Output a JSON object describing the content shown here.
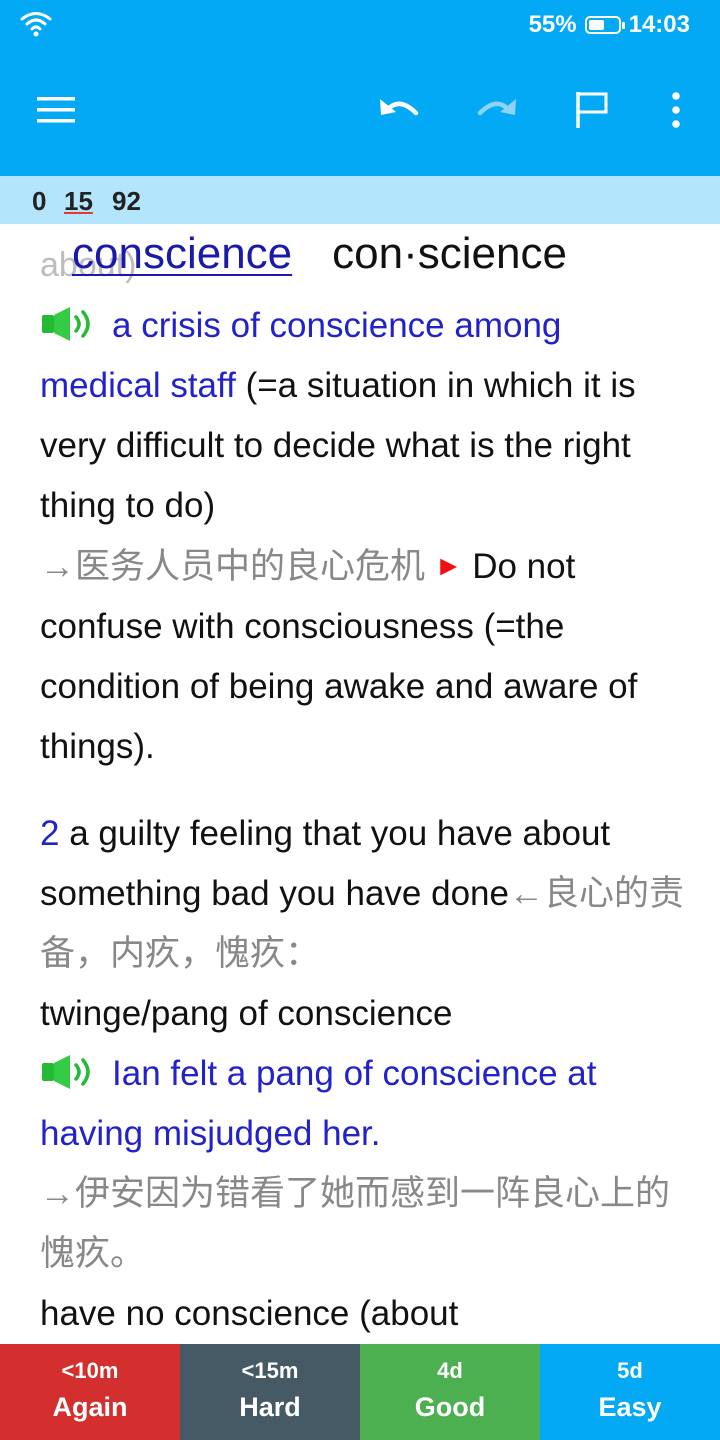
{
  "status": {
    "battery": "55%",
    "battery_level": 0.55,
    "time": "14:03"
  },
  "toolbar": {
    "icons": [
      "menu-icon",
      "undo-icon",
      "redo-icon",
      "flag-icon",
      "more-vert-icon"
    ]
  },
  "counts": {
    "new": "0",
    "learning": "15",
    "review": "92"
  },
  "card": {
    "ghost_text": "about)",
    "headword": "conscience",
    "syllables": "con·science",
    "example1_en": "a crisis of conscience among medical staff",
    "example1_note": " (=a situation in which it is very difficult to decide what is the right thing to do)",
    "example1_zh": "→医务人员中的良心危机",
    "confuse_marker": "►",
    "confuse_note": " Do not confuse with consciousness (=the condition of being awake and aware of things).",
    "sense2_num": "2",
    "sense2_def": " a guilty feeling that you have about something bad you have done",
    "sense2_zh": "←良心的责备，内疚，愧疚：",
    "phrase": "twinge/pang of conscience",
    "example2_en": "Ian felt a pang of conscience at having misjudged her.",
    "example2_zh": "→伊安因为错看了她而感到一阵良心上的愧疚。",
    "phrase2": "have no conscience (about"
  },
  "answers": [
    {
      "interval": "<10m",
      "label": "Again",
      "color": "#D32F2F"
    },
    {
      "interval": "<15m",
      "label": "Hard",
      "color": "#455A64"
    },
    {
      "interval": "4d",
      "label": "Good",
      "color": "#4CAF50"
    },
    {
      "interval": "5d",
      "label": "Easy",
      "color": "#03A9F4"
    }
  ]
}
